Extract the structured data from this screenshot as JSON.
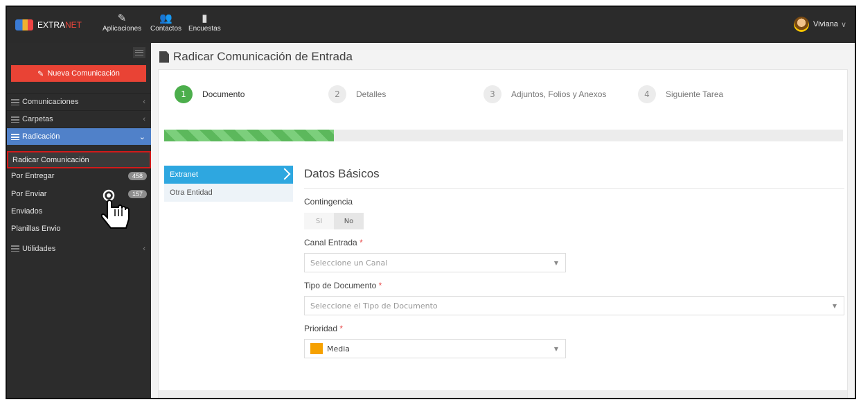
{
  "topbar": {
    "brand_a": "EXTRA",
    "brand_b": "NET",
    "nav": [
      {
        "label": "Aplicaciones",
        "icon": "pencil-icon"
      },
      {
        "label": "Contactos",
        "icon": "people-icon"
      },
      {
        "label": "Encuestas",
        "icon": "document-icon"
      }
    ],
    "user": "Viviana",
    "user_chevron": "∨"
  },
  "sidebar": {
    "new_button": "Nueva Comunicación",
    "sections": [
      {
        "label": "Comunicaciones",
        "chevron": "‹"
      },
      {
        "label": "Carpetas",
        "chevron": "‹"
      },
      {
        "label": "Radicación",
        "chevron": "⌄"
      }
    ],
    "sub_items": [
      {
        "label": "Radicar Comunicación",
        "badge": ""
      },
      {
        "label": "Por Entregar",
        "badge": "458"
      },
      {
        "label": "Por Enviar",
        "badge": "157"
      },
      {
        "label": "Enviados",
        "badge": ""
      },
      {
        "label": "Planillas Envio",
        "badge": ""
      }
    ],
    "utilities": {
      "label": "Utilidades",
      "chevron": "‹"
    }
  },
  "page": {
    "title": "Radicar Comunicación de Entrada",
    "steps": [
      {
        "num": "1",
        "label": "Documento"
      },
      {
        "num": "2",
        "label": "Detalles"
      },
      {
        "num": "3",
        "label": "Adjuntos, Folios y Anexos"
      },
      {
        "num": "4",
        "label": "Siguiente Tarea"
      }
    ],
    "progress_pct": 25,
    "tabs": [
      "Extranet",
      "Otra Entidad"
    ],
    "section_title": "Datos Básicos",
    "contingencia": {
      "label": "Contingencia",
      "si": "SI",
      "no": "No"
    },
    "canal": {
      "label": "Canal Entrada",
      "required": "*",
      "placeholder": "Seleccione un Canal"
    },
    "tipo": {
      "label": "Tipo de Documento",
      "required": "*",
      "placeholder": "Seleccione el Tipo de Documento"
    },
    "prioridad": {
      "label": "Prioridad",
      "required": "*",
      "value": "Media",
      "color": "#f6a100"
    }
  }
}
